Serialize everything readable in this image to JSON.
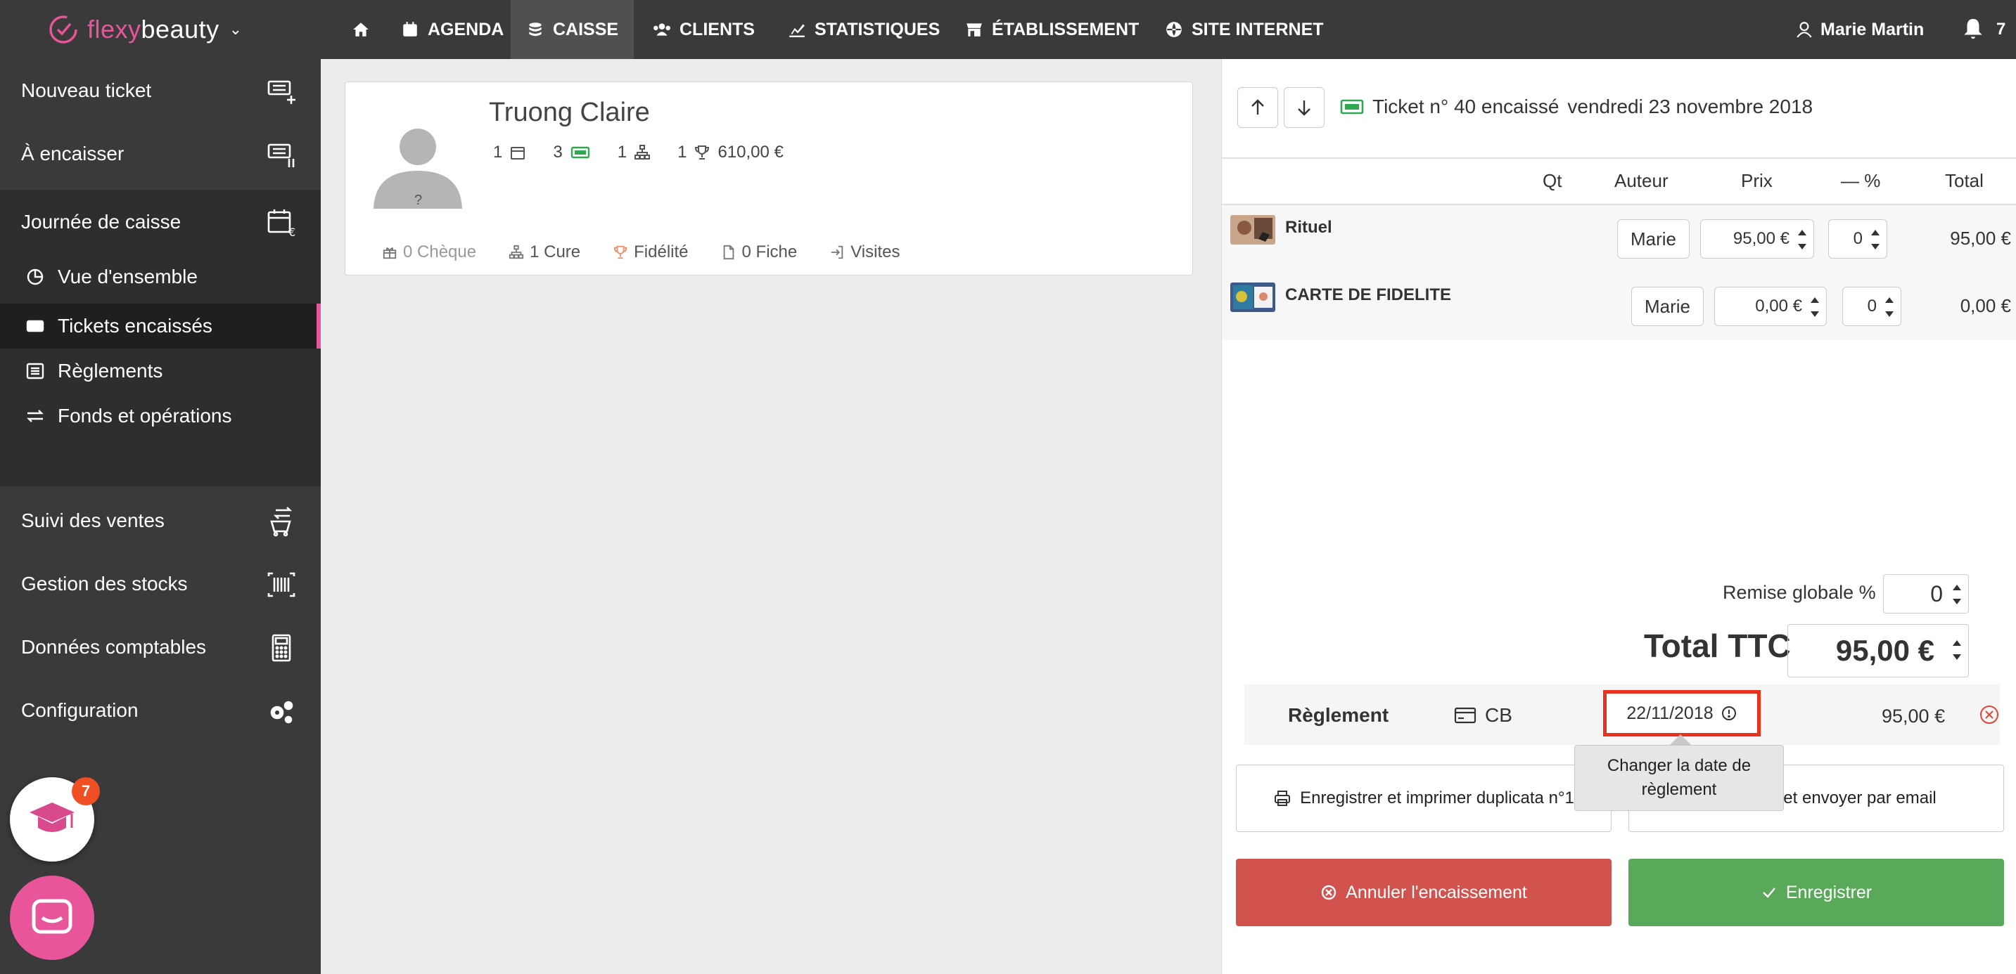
{
  "brand": {
    "part1": "flexy",
    "part2": "beauty"
  },
  "nav": {
    "items": [
      {
        "label": ""
      },
      {
        "label": "AGENDA"
      },
      {
        "label": "CAISSE"
      },
      {
        "label": "CLIENTS"
      },
      {
        "label": "STATISTIQUES"
      },
      {
        "label": "ÉTABLISSEMENT"
      },
      {
        "label": "SITE INTERNET"
      }
    ],
    "user": "Marie Martin",
    "notifications": "7"
  },
  "sidebar": {
    "items": [
      {
        "label": "Nouveau ticket"
      },
      {
        "label": "À encaisser"
      },
      {
        "label": "Journée de caisse"
      },
      {
        "label": "Suivi des ventes"
      },
      {
        "label": "Gestion des stocks"
      },
      {
        "label": "Données comptables"
      },
      {
        "label": "Configuration"
      }
    ],
    "sub": [
      {
        "label": "Vue d'ensemble"
      },
      {
        "label": "Tickets encaissés"
      },
      {
        "label": "Règlements"
      },
      {
        "label": "Fonds et opérations"
      }
    ],
    "grad_badge": "7"
  },
  "client": {
    "name": "Truong Claire",
    "avatar_mark": "?",
    "stats": {
      "appointments": "1",
      "tickets": "3",
      "cures": "1",
      "fidelity": "1",
      "amount": "610,00 €"
    },
    "tabs": [
      {
        "label": "0 Chèque"
      },
      {
        "label": "1 Cure"
      },
      {
        "label": "Fidélité"
      },
      {
        "label": "0 Fiche"
      },
      {
        "label": "Visites"
      }
    ]
  },
  "ticket": {
    "title": "Ticket n° 40 encaissé",
    "date": "vendredi 23 novembre 2018",
    "columns": {
      "qt": "Qt",
      "auteur": "Auteur",
      "prix": "Prix",
      "pct": "— %",
      "total": "Total"
    },
    "lines": [
      {
        "name": "Rituel",
        "author": "Marie",
        "price": "95,00 €",
        "pct": "0",
        "total": "95,00 €"
      },
      {
        "name": "CARTE DE FIDELITE",
        "author": "Marie",
        "price": "0,00 €",
        "pct": "0",
        "total": "0,00 €"
      }
    ],
    "remise_label": "Remise globale %",
    "remise_value": "0",
    "ttc_label": "Total TTC",
    "ttc_value": "95,00 €",
    "reglement": {
      "label": "Règlement",
      "mode": "CB",
      "date": "22/11/2018",
      "amount": "95,00 €"
    },
    "tooltip": {
      "line1": "Changer la date de",
      "line2": "règlement"
    },
    "btn_print": "Enregistrer et imprimer duplicata n°1",
    "btn_email": "Enregistrer et envoyer par email",
    "btn_cancel": "Annuler l'encaissement",
    "btn_save": "Enregistrer"
  },
  "colors": {
    "accent": "#e8559a",
    "nav_bg": "#3a3a3a",
    "danger": "#d2534d",
    "success": "#5aa95a",
    "highlight": "#e8321e"
  }
}
